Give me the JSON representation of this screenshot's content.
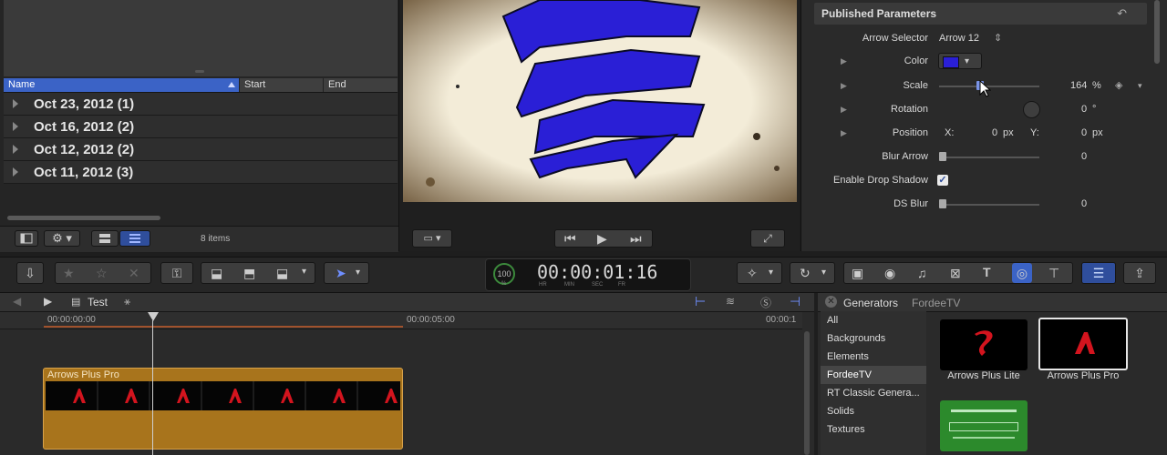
{
  "library": {
    "columns": {
      "name": "Name",
      "start": "Start",
      "end": "End"
    },
    "events": [
      {
        "label": "Oct 23, 2012  (1)"
      },
      {
        "label": "Oct 16, 2012  (2)"
      },
      {
        "label": "Oct 12, 2012  (2)"
      },
      {
        "label": "Oct 11, 2012  (3)"
      }
    ],
    "item_count": "8 items"
  },
  "inspector": {
    "title": "Published Parameters",
    "arrow_selector_label": "Arrow Selector",
    "arrow_selector_value": "Arrow 12",
    "color_label": "Color",
    "color_value": "#2a1fd6",
    "scale_label": "Scale",
    "scale_value": "164",
    "scale_unit": "%",
    "rotation_label": "Rotation",
    "rotation_value": "0",
    "rotation_unit": "°",
    "position_label": "Position",
    "pos_x_label": "X:",
    "pos_x_value": "0",
    "pos_x_unit": "px",
    "pos_y_label": "Y:",
    "pos_y_value": "0",
    "pos_y_unit": "px",
    "blur_arrow_label": "Blur Arrow",
    "blur_arrow_value": "0",
    "drop_shadow_label": "Enable Drop Shadow",
    "drop_shadow_checked": true,
    "ds_blur_label": "DS Blur",
    "ds_blur_value": "0"
  },
  "timecode": {
    "percent": "100",
    "percent_unit": "%",
    "value": "00:00:01:16",
    "units": [
      "HR",
      "MIN",
      "SEC",
      "FR"
    ]
  },
  "timeline": {
    "project_name": "Test",
    "ruler": [
      "00:00:00:00",
      "00:00:05:00",
      "00:00:1"
    ],
    "clip_title": "Arrows Plus Pro",
    "clip_color": "#a8741c"
  },
  "generators": {
    "title": "Generators",
    "breadcrumb": "FordeeTV",
    "categories": [
      "All",
      "Backgrounds",
      "Elements",
      "FordeeTV",
      "RT Classic Genera...",
      "Solids",
      "Textures"
    ],
    "selected_category": "FordeeTV",
    "items": [
      {
        "label": "Arrows Plus Lite"
      },
      {
        "label": "Arrows Plus Pro"
      }
    ]
  },
  "colors": {
    "accent": "#3b63c6",
    "arrow_blue": "#2a1fd6"
  }
}
